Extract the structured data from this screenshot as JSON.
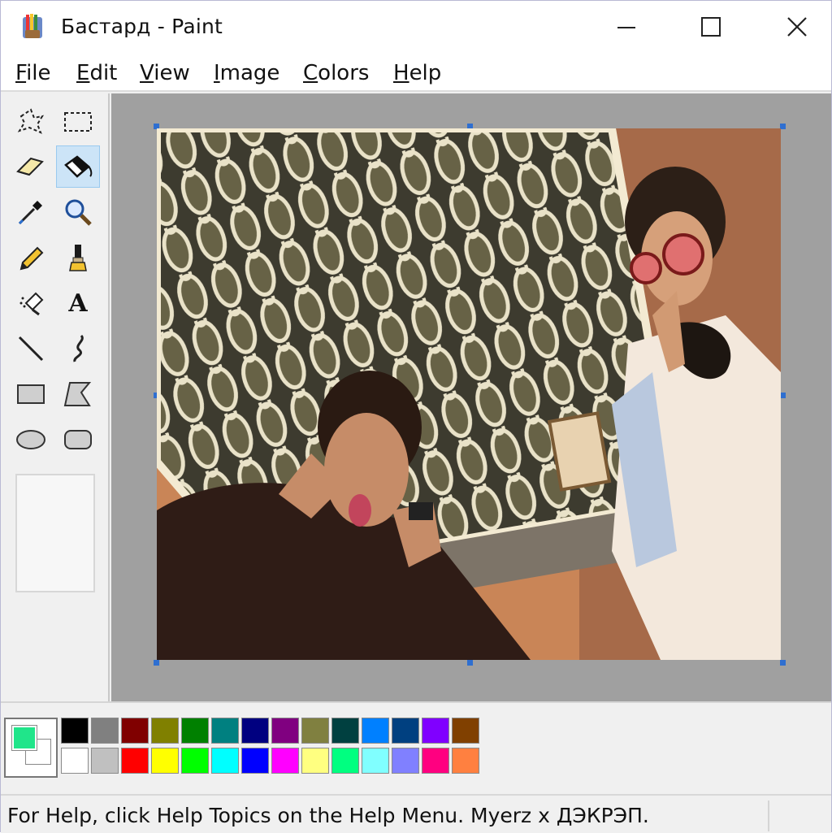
{
  "window": {
    "title": "Бастард - Paint",
    "controls": [
      "minimize",
      "maximize",
      "close"
    ]
  },
  "menu": [
    {
      "label": "File",
      "underline": "F"
    },
    {
      "label": "Edit",
      "underline": "E"
    },
    {
      "label": "View",
      "underline": "V"
    },
    {
      "label": "Image",
      "underline": "I"
    },
    {
      "label": "Colors",
      "underline": "C"
    },
    {
      "label": "Help",
      "underline": "H"
    }
  ],
  "tools": [
    {
      "name": "free-form-select-icon"
    },
    {
      "name": "select-icon"
    },
    {
      "name": "eraser-icon"
    },
    {
      "name": "fill-bucket-icon",
      "selected": true
    },
    {
      "name": "color-picker-icon"
    },
    {
      "name": "magnifier-icon"
    },
    {
      "name": "pencil-icon"
    },
    {
      "name": "brush-icon"
    },
    {
      "name": "airbrush-icon"
    },
    {
      "name": "text-icon",
      "glyph": "A"
    },
    {
      "name": "line-icon"
    },
    {
      "name": "curve-icon"
    },
    {
      "name": "rectangle-icon"
    },
    {
      "name": "polygon-icon"
    },
    {
      "name": "ellipse-icon"
    },
    {
      "name": "rounded-rectangle-icon"
    }
  ],
  "colors": {
    "foreground": "#20e58a",
    "background": "#ffffff",
    "palette_top": [
      "#000000",
      "#808080",
      "#800000",
      "#808000",
      "#008000",
      "#008080",
      "#000080",
      "#800080",
      "#808040",
      "#004040",
      "#0080ff",
      "#004080",
      "#8000ff",
      "#804000"
    ],
    "palette_bottom": [
      "#ffffff",
      "#c0c0c0",
      "#ff0000",
      "#ffff00",
      "#00ff00",
      "#00ffff",
      "#0000ff",
      "#ff00ff",
      "#ffff80",
      "#00ff80",
      "#80ffff",
      "#8080ff",
      "#ff0080",
      "#ff8040"
    ]
  },
  "status": {
    "text": "For Help, click Help Topics on the Help Menu. Myerz x ДЭКРЭП."
  }
}
